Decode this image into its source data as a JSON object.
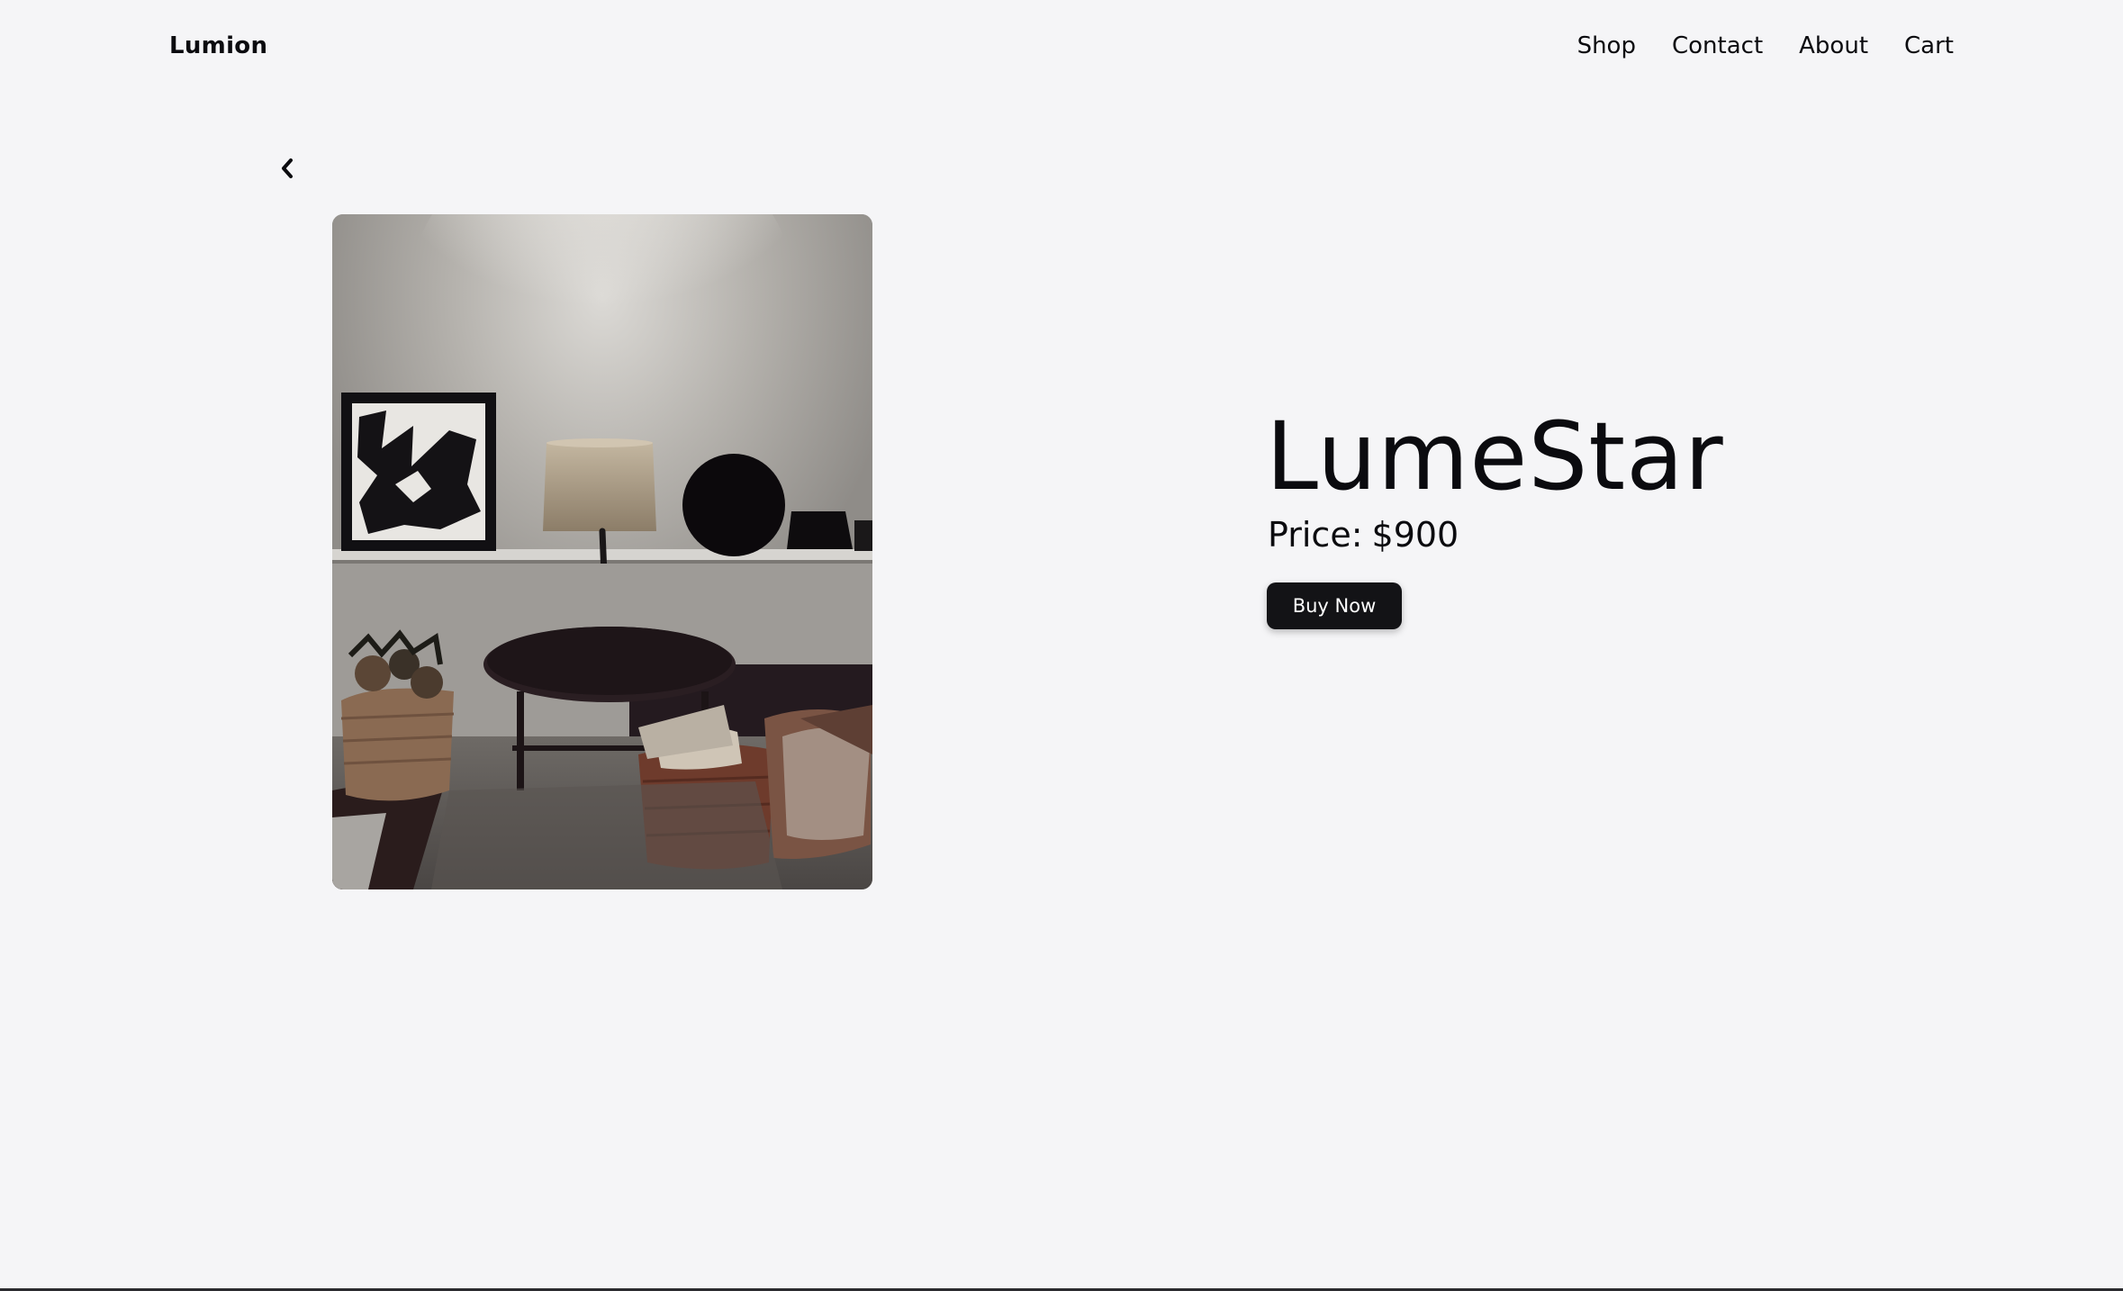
{
  "header": {
    "brand": "Lumion",
    "nav": {
      "shop": "Shop",
      "contact": "Contact",
      "about": "About",
      "cart": "Cart"
    }
  },
  "back": {
    "icon": "chevron-left-icon"
  },
  "product": {
    "name": "LumeStar",
    "price_label": "Price:",
    "price_value": "$900",
    "buy_label": "Buy Now"
  },
  "colors": {
    "background": "#f5f5f7",
    "text": "#0b0b0f",
    "button": "#131316",
    "button_text": "#ffffff"
  }
}
